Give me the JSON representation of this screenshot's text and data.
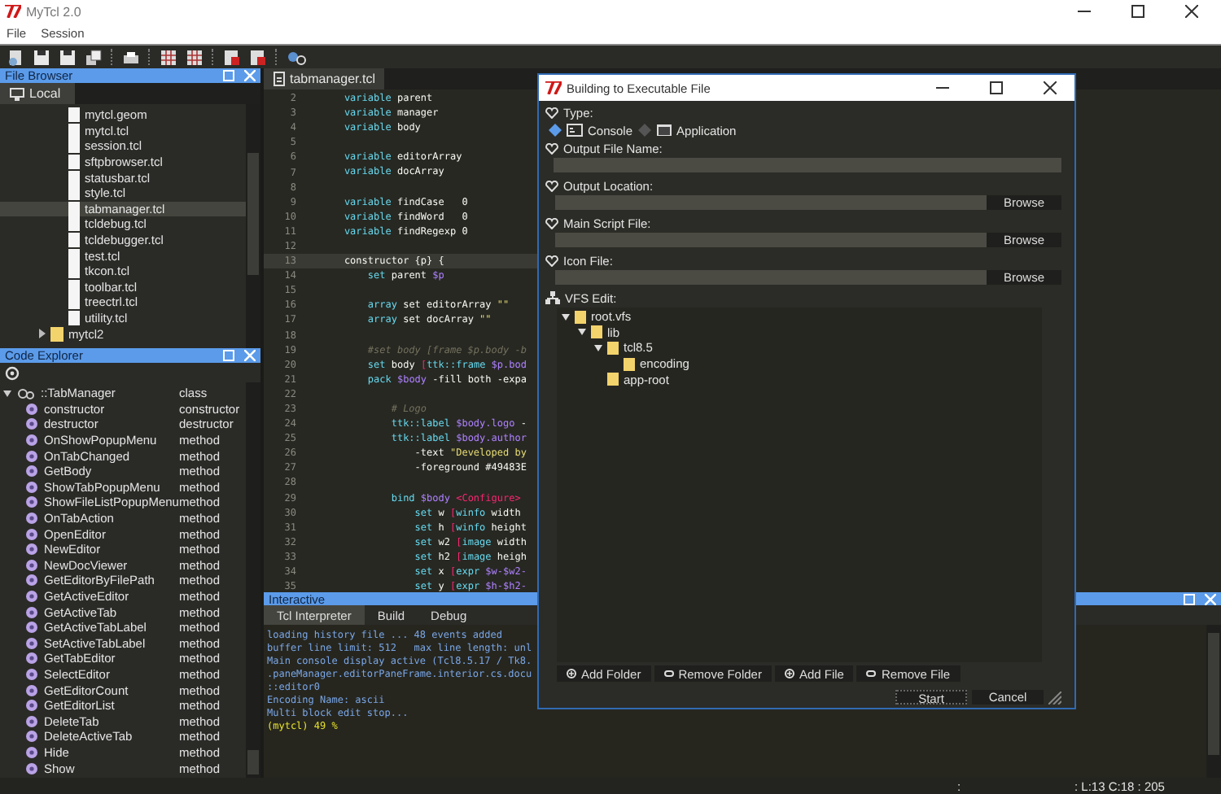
{
  "window": {
    "title": "MyTcl 2.0"
  },
  "menu": [
    "File",
    "Session"
  ],
  "file_browser": {
    "title": "File Browser",
    "tab": "Local",
    "items": [
      {
        "name": "mytcl.geom",
        "kind": "file",
        "selected": false
      },
      {
        "name": "mytcl.tcl",
        "kind": "file",
        "selected": false
      },
      {
        "name": "session.tcl",
        "kind": "file",
        "selected": false
      },
      {
        "name": "sftpbrowser.tcl",
        "kind": "file",
        "selected": false
      },
      {
        "name": "statusbar.tcl",
        "kind": "file",
        "selected": false
      },
      {
        "name": "style.tcl",
        "kind": "file",
        "selected": false
      },
      {
        "name": "tabmanager.tcl",
        "kind": "file",
        "selected": true
      },
      {
        "name": "tcldebug.tcl",
        "kind": "file",
        "selected": false
      },
      {
        "name": "tcldebugger.tcl",
        "kind": "file",
        "selected": false
      },
      {
        "name": "test.tcl",
        "kind": "file",
        "selected": false
      },
      {
        "name": "tkcon.tcl",
        "kind": "file",
        "selected": false
      },
      {
        "name": "toolbar.tcl",
        "kind": "file",
        "selected": false
      },
      {
        "name": "treectrl.tcl",
        "kind": "file",
        "selected": false
      },
      {
        "name": "utility.tcl",
        "kind": "file",
        "selected": false
      },
      {
        "name": "mytcl2",
        "kind": "folder",
        "selected": false
      }
    ]
  },
  "code_explorer": {
    "title": "Code Explorer",
    "tree": [
      {
        "name": "::TabManager",
        "type": "class",
        "expanded": true,
        "children": [
          {
            "name": "constructor",
            "type": "constructor"
          },
          {
            "name": "destructor",
            "type": "destructor"
          },
          {
            "name": "OnShowPopupMenu",
            "type": "method"
          },
          {
            "name": "OnTabChanged",
            "type": "method"
          },
          {
            "name": "GetBody",
            "type": "method"
          },
          {
            "name": "ShowTabPopupMenu",
            "type": "method"
          },
          {
            "name": "ShowFileListPopupMenu",
            "type": "method"
          },
          {
            "name": "OnTabAction",
            "type": "method"
          },
          {
            "name": "OpenEditor",
            "type": "method"
          },
          {
            "name": "NewEditor",
            "type": "method"
          },
          {
            "name": "NewDocViewer",
            "type": "method"
          },
          {
            "name": "GetEditorByFilePath",
            "type": "method"
          },
          {
            "name": "GetActiveEditor",
            "type": "method"
          },
          {
            "name": "GetActiveTab",
            "type": "method"
          },
          {
            "name": "GetActiveTabLabel",
            "type": "method"
          },
          {
            "name": "SetActiveTabLabel",
            "type": "method"
          },
          {
            "name": "GetTabEditor",
            "type": "method"
          },
          {
            "name": "SelectEditor",
            "type": "method"
          },
          {
            "name": "GetEditorCount",
            "type": "method"
          },
          {
            "name": "GetEditorList",
            "type": "method"
          },
          {
            "name": "DeleteTab",
            "type": "method"
          },
          {
            "name": "DeleteActiveTab",
            "type": "method"
          },
          {
            "name": "Hide",
            "type": "method"
          },
          {
            "name": "Show",
            "type": "method"
          }
        ]
      }
    ]
  },
  "editor": {
    "tab": "tabmanager.tcl",
    "lines": [
      {
        "num": "2",
        "current": false,
        "tokens": [
          {
            "text": "    variable",
            "kind": "keyword"
          },
          {
            "text": " parent",
            "kind": "plain"
          }
        ]
      },
      {
        "num": "3",
        "current": false,
        "tokens": [
          {
            "text": "    variable",
            "kind": "keyword"
          },
          {
            "text": " manager",
            "kind": "plain"
          }
        ]
      },
      {
        "num": "4",
        "current": false,
        "tokens": [
          {
            "text": "    variable",
            "kind": "keyword"
          },
          {
            "text": " body",
            "kind": "plain"
          }
        ]
      },
      {
        "num": "5",
        "current": false
      },
      {
        "num": "6",
        "current": false,
        "tokens": [
          {
            "text": "    variable",
            "kind": "keyword"
          },
          {
            "text": " editorArray",
            "kind": "plain"
          }
        ]
      },
      {
        "num": "7",
        "current": false,
        "tokens": [
          {
            "text": "    variable",
            "kind": "keyword"
          },
          {
            "text": " docArray",
            "kind": "plain"
          }
        ]
      },
      {
        "num": "8",
        "current": false
      },
      {
        "num": "9",
        "current": false,
        "tokens": [
          {
            "text": "    variable",
            "kind": "keyword"
          },
          {
            "text": " findCase   0",
            "kind": "plain"
          }
        ]
      },
      {
        "num": "10",
        "current": false,
        "tokens": [
          {
            "text": "    variable",
            "kind": "keyword"
          },
          {
            "text": " findWord   0",
            "kind": "plain"
          }
        ]
      },
      {
        "num": "11",
        "current": false,
        "tokens": [
          {
            "text": "    variable",
            "kind": "keyword"
          },
          {
            "text": " findRegexp 0",
            "kind": "plain"
          }
        ]
      },
      {
        "num": "12",
        "current": false
      },
      {
        "num": "13",
        "current": true,
        "tokens": [
          {
            "text": "    constructor {p} {",
            "kind": "plain"
          }
        ]
      },
      {
        "num": "14",
        "current": false,
        "tokens": [
          {
            "text": "        set",
            "kind": "keyword"
          },
          {
            "text": " parent ",
            "kind": "plain"
          },
          {
            "text": "$p",
            "kind": "variable"
          }
        ]
      },
      {
        "num": "15",
        "current": false
      },
      {
        "num": "16",
        "current": false,
        "tokens": [
          {
            "text": "        array",
            "kind": "keyword"
          },
          {
            "text": " set editorArray ",
            "kind": "plain"
          },
          {
            "text": "\"\"",
            "kind": "string"
          }
        ]
      },
      {
        "num": "17",
        "current": false,
        "tokens": [
          {
            "text": "        array",
            "kind": "keyword"
          },
          {
            "text": " set docArray ",
            "kind": "plain"
          },
          {
            "text": "\"\"",
            "kind": "string"
          }
        ]
      },
      {
        "num": "18",
        "current": false
      },
      {
        "num": "19",
        "current": false,
        "tokens": [
          {
            "text": "        #set body [frame $p.body -b",
            "kind": "comment"
          }
        ]
      },
      {
        "num": "20",
        "current": false,
        "tokens": [
          {
            "text": "        set",
            "kind": "keyword"
          },
          {
            "text": " body ",
            "kind": "plain"
          },
          {
            "text": "[",
            "kind": "bracket"
          },
          {
            "text": "ttk::frame",
            "kind": "keyword"
          },
          {
            "text": " $p.bod",
            "kind": "variable"
          }
        ]
      },
      {
        "num": "21",
        "current": false,
        "tokens": [
          {
            "text": "        pack",
            "kind": "keyword"
          },
          {
            "text": " $body",
            "kind": "variable"
          },
          {
            "text": " -fill both -expa",
            "kind": "plain"
          }
        ]
      },
      {
        "num": "22",
        "current": false
      },
      {
        "num": "23",
        "current": false,
        "tokens": [
          {
            "text": "            # Logo",
            "kind": "comment"
          }
        ]
      },
      {
        "num": "24",
        "current": false,
        "tokens": [
          {
            "text": "            ttk::label",
            "kind": "keyword"
          },
          {
            "text": " $body.logo",
            "kind": "variable"
          },
          {
            "text": " -",
            "kind": "plain"
          }
        ]
      },
      {
        "num": "25",
        "current": false,
        "tokens": [
          {
            "text": "            ttk::label",
            "kind": "keyword"
          },
          {
            "text": " $body.author",
            "kind": "variable"
          }
        ]
      },
      {
        "num": "26",
        "current": false,
        "tokens": [
          {
            "text": "                -text ",
            "kind": "plain"
          },
          {
            "text": "\"Developed by",
            "kind": "string"
          }
        ]
      },
      {
        "num": "27",
        "current": false,
        "tokens": [
          {
            "text": "                -foreground #49483E",
            "kind": "plain"
          }
        ]
      },
      {
        "num": "28",
        "current": false
      },
      {
        "num": "29",
        "current": false,
        "tokens": [
          {
            "text": "            bind",
            "kind": "keyword"
          },
          {
            "text": " $body",
            "kind": "variable"
          },
          {
            "text": " <Configure>",
            "kind": "bracket"
          }
        ]
      },
      {
        "num": "30",
        "current": false,
        "tokens": [
          {
            "text": "                set",
            "kind": "keyword"
          },
          {
            "text": " w ",
            "kind": "plain"
          },
          {
            "text": "[",
            "kind": "bracket"
          },
          {
            "text": "winfo",
            "kind": "keyword"
          },
          {
            "text": " width",
            "kind": "plain"
          }
        ]
      },
      {
        "num": "31",
        "current": false,
        "tokens": [
          {
            "text": "                set",
            "kind": "keyword"
          },
          {
            "text": " h ",
            "kind": "plain"
          },
          {
            "text": "[",
            "kind": "bracket"
          },
          {
            "text": "winfo",
            "kind": "keyword"
          },
          {
            "text": " height",
            "kind": "plain"
          }
        ]
      },
      {
        "num": "32",
        "current": false,
        "tokens": [
          {
            "text": "                set",
            "kind": "keyword"
          },
          {
            "text": " w2 ",
            "kind": "plain"
          },
          {
            "text": "[",
            "kind": "bracket"
          },
          {
            "text": "image",
            "kind": "keyword"
          },
          {
            "text": " width",
            "kind": "plain"
          }
        ]
      },
      {
        "num": "33",
        "current": false,
        "tokens": [
          {
            "text": "                set",
            "kind": "keyword"
          },
          {
            "text": " h2 ",
            "kind": "plain"
          },
          {
            "text": "[",
            "kind": "bracket"
          },
          {
            "text": "image",
            "kind": "keyword"
          },
          {
            "text": " heigh",
            "kind": "plain"
          }
        ]
      },
      {
        "num": "34",
        "current": false,
        "tokens": [
          {
            "text": "                set",
            "kind": "keyword"
          },
          {
            "text": " x ",
            "kind": "plain"
          },
          {
            "text": "[",
            "kind": "bracket"
          },
          {
            "text": "expr",
            "kind": "keyword"
          },
          {
            "text": " $w-$w2-",
            "kind": "variable"
          }
        ]
      },
      {
        "num": "35",
        "current": false,
        "tokens": [
          {
            "text": "                set",
            "kind": "keyword"
          },
          {
            "text": " y ",
            "kind": "plain"
          },
          {
            "text": "[",
            "kind": "bracket"
          },
          {
            "text": "expr",
            "kind": "keyword"
          },
          {
            "text": " $h-$h2-",
            "kind": "variable"
          }
        ]
      }
    ]
  },
  "interactive": {
    "title": "Interactive",
    "tabs": [
      {
        "label": "Tcl Interpreter",
        "selected": true
      },
      {
        "label": "Build",
        "selected": false
      },
      {
        "label": "Debug",
        "selected": false
      }
    ],
    "lines": [
      {
        "text": "loading history file ... 48 events added",
        "kind": "output"
      },
      {
        "text": "buffer line limit: 512   max line length: unl",
        "kind": "output"
      },
      {
        "text": "Main console display active (Tcl8.5.17 / Tk8.",
        "kind": "output"
      },
      {
        "text": ".paneManager.editorPaneFrame.interior.cs.docu",
        "kind": "output"
      },
      {
        "text": "::editor0",
        "kind": "output"
      },
      {
        "text": "Encoding Name: ascii",
        "kind": "output"
      },
      {
        "text": "Multi block edit stop...",
        "kind": "output"
      },
      {
        "text": "(mytcl) 49 %",
        "kind": "prompt"
      }
    ]
  },
  "status_bar": {
    "left": ":",
    "right": ": L:13 C:18 : 205"
  },
  "dialog": {
    "title": "Building to Executable File",
    "type_label": "Type:",
    "types": [
      {
        "label": "Console",
        "selected": true
      },
      {
        "label": "Application",
        "selected": false
      }
    ],
    "fields": [
      {
        "label": "Output File Name:",
        "kind": "plain"
      },
      {
        "label": "Output Location:",
        "kind": "browse",
        "button": "Browse"
      },
      {
        "label": "Main Script File:",
        "kind": "browse",
        "button": "Browse"
      },
      {
        "label": "Icon File:",
        "kind": "browse",
        "button": "Browse"
      }
    ],
    "vfs_label": "VFS Edit:",
    "vfs_tree": [
      {
        "name": "root.vfs",
        "expanded": true,
        "children": [
          {
            "name": "lib",
            "expanded": true,
            "children": [
              {
                "name": "tcl8.5",
                "expanded": true,
                "children": [
                  {
                    "name": "encoding"
                  }
                ]
              },
              {
                "name": "app-root"
              }
            ]
          }
        ]
      }
    ],
    "actions": [
      {
        "label": "Add Folder",
        "kind": "add"
      },
      {
        "label": "Remove Folder",
        "kind": "remove"
      },
      {
        "label": "Add File",
        "kind": "add"
      },
      {
        "label": "Remove File",
        "kind": "remove"
      }
    ],
    "buttons": [
      {
        "label": "Start",
        "kind": "default"
      },
      {
        "label": "Cancel",
        "kind": "normal"
      }
    ]
  }
}
